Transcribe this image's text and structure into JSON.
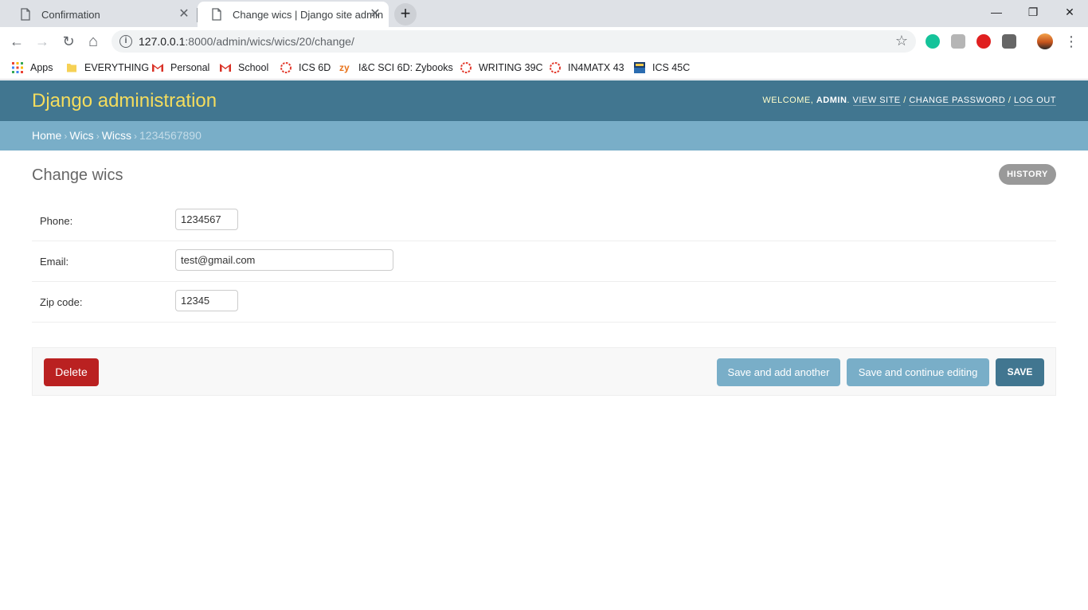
{
  "browser": {
    "tabs": [
      {
        "title": "Confirmation",
        "close": "✕"
      },
      {
        "title": "Change wics | Django site admin",
        "close": "✕"
      }
    ],
    "new_tab": "+",
    "window_controls": {
      "minimize": "—",
      "restore": "❐",
      "close": "✕"
    },
    "nav": {
      "back": "←",
      "forward": "→",
      "reload": "↻",
      "home": "⌂"
    },
    "url_host": "127.0.0.1",
    "url_rest": ":8000/admin/wics/wics/20/change/",
    "star": "☆",
    "menu": "⋮",
    "bookmarks": [
      {
        "label": "Apps",
        "icon": "apps-grid-icon"
      },
      {
        "label": "EVERYTHING",
        "icon": "folder-icon"
      },
      {
        "label": "Personal",
        "icon": "gmail-icon"
      },
      {
        "label": "School",
        "icon": "gmail-icon"
      },
      {
        "label": "ICS 6D",
        "icon": "canvas-icon"
      },
      {
        "label": "I&C SCI 6D: Zybooks",
        "icon": "zybooks-icon"
      },
      {
        "label": "WRITING 39C",
        "icon": "canvas-icon"
      },
      {
        "label": "IN4MATX 43",
        "icon": "canvas-icon"
      },
      {
        "label": "ICS 45C",
        "icon": "uci-ics-icon"
      }
    ]
  },
  "admin": {
    "branding": "Django administration",
    "welcome": "WELCOME,",
    "user": "ADMIN",
    "view_site": "VIEW SITE",
    "change_password": "CHANGE PASSWORD",
    "log_out": "LOG OUT",
    "breadcrumbs": [
      "Home",
      "Wics",
      "Wicss",
      "1234567890"
    ],
    "title": "Change wics",
    "history": "HISTORY",
    "fields": [
      {
        "label": "Phone:",
        "value": "1234567"
      },
      {
        "label": "Email:",
        "value": "test@gmail.com"
      },
      {
        "label": "Zip code:",
        "value": "12345"
      }
    ],
    "buttons": {
      "delete": "Delete",
      "save_add_another": "Save and add another",
      "save_continue": "Save and continue editing",
      "save": "SAVE"
    }
  }
}
